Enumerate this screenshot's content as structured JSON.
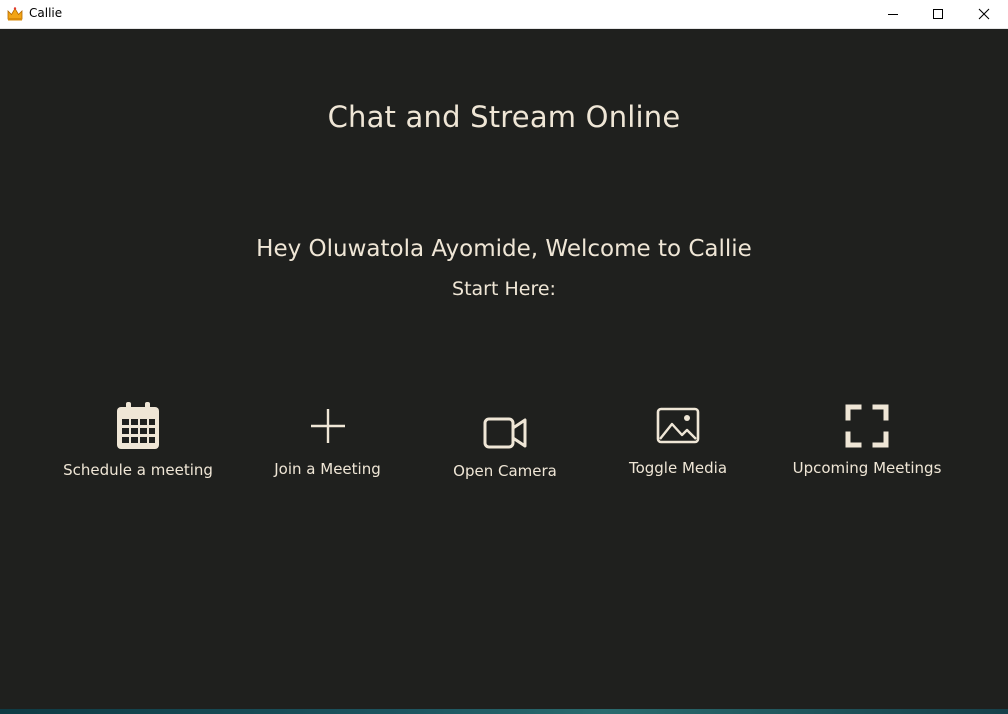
{
  "window": {
    "title": "Callie",
    "app_icon": "crown-icon",
    "controls": [
      "minimize-icon",
      "maximize-icon",
      "close-icon"
    ]
  },
  "main": {
    "headline": "Chat and Stream Online",
    "welcome": "Hey Oluwatola Ayomide, Welcome to Callie",
    "start_here": "Start Here:"
  },
  "actions": [
    {
      "label": "Schedule a meeting",
      "icon": "calendar-icon"
    },
    {
      "label": "Join a Meeting",
      "icon": "plus-icon"
    },
    {
      "label": "Open Camera",
      "icon": "video-camera-icon"
    },
    {
      "label": "Toggle Media",
      "icon": "image-icon"
    },
    {
      "label": "Upcoming Meetings",
      "icon": "fullscreen-corners-icon"
    }
  ],
  "colors": {
    "background": "#1f201e",
    "foreground": "#efe6d6",
    "titlebar": "#ffffff"
  }
}
